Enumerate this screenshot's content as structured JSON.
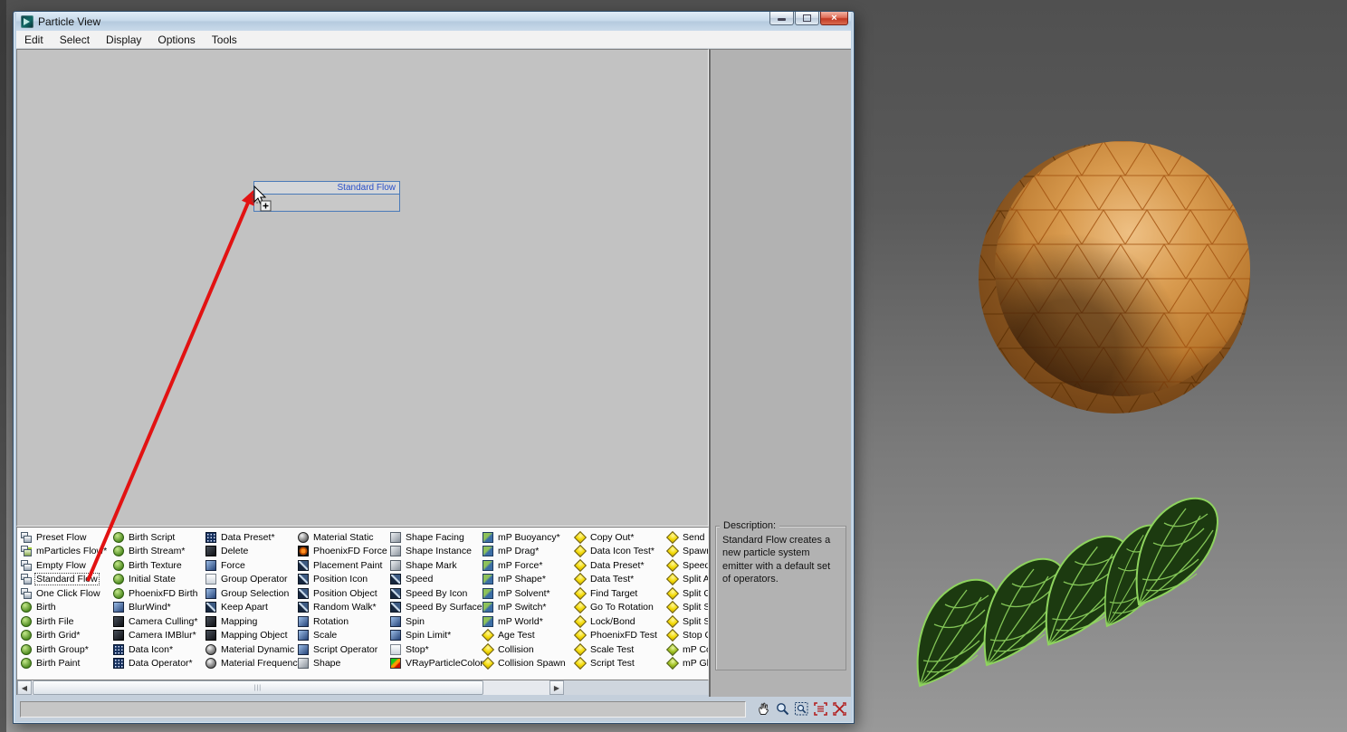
{
  "window": {
    "title": "Particle View",
    "controls": [
      "minimize",
      "restore",
      "close"
    ],
    "menu": {
      "items": [
        "Edit",
        "Select",
        "Display",
        "Options",
        "Tools"
      ]
    }
  },
  "canvas": {
    "node": {
      "title": "Standard Flow"
    }
  },
  "description_panel": {
    "label": "Description:",
    "text": "Standard Flow creates a new particle system emitter with a default set of operators."
  },
  "depot": {
    "columns": [
      {
        "items": [
          {
            "label": "Preset Flow",
            "icon": "flow"
          },
          {
            "label": "mParticles Flow*",
            "icon": "flow-m"
          },
          {
            "label": "Empty Flow",
            "icon": "flow"
          },
          {
            "label": "Standard Flow",
            "icon": "flow",
            "selected": true
          },
          {
            "label": "One Click Flow",
            "icon": "flow"
          },
          {
            "label": "Birth",
            "icon": "green"
          },
          {
            "label": "Birth File",
            "icon": "green"
          },
          {
            "label": "Birth Grid*",
            "icon": "green"
          },
          {
            "label": "Birth Group*",
            "icon": "green"
          },
          {
            "label": "Birth Paint",
            "icon": "green"
          }
        ]
      },
      {
        "items": [
          {
            "label": "Birth Script",
            "icon": "green"
          },
          {
            "label": "Birth Stream*",
            "icon": "green"
          },
          {
            "label": "Birth Texture",
            "icon": "green"
          },
          {
            "label": "Initial State",
            "icon": "green"
          },
          {
            "label": "PhoenixFD Birth",
            "icon": "green"
          },
          {
            "label": "BlurWind*",
            "icon": "blue"
          },
          {
            "label": "Camera Culling*",
            "icon": "dark"
          },
          {
            "label": "Camera IMBlur*",
            "icon": "dark"
          },
          {
            "label": "Data Icon*",
            "icon": "data"
          },
          {
            "label": "Data Operator*",
            "icon": "data"
          }
        ]
      },
      {
        "items": [
          {
            "label": "Data Preset*",
            "icon": "data"
          },
          {
            "label": "Delete",
            "icon": "dark"
          },
          {
            "label": "Force",
            "icon": "blue"
          },
          {
            "label": "Group Operator",
            "icon": "light"
          },
          {
            "label": "Group Selection",
            "icon": "blue"
          },
          {
            "label": "Keep Apart",
            "icon": "navy"
          },
          {
            "label": "Mapping",
            "icon": "dark"
          },
          {
            "label": "Mapping Object",
            "icon": "dark"
          },
          {
            "label": "Material Dynamic",
            "icon": "sphere"
          },
          {
            "label": "Material Frequency",
            "icon": "sphere"
          }
        ]
      },
      {
        "items": [
          {
            "label": "Material Static",
            "icon": "sphere"
          },
          {
            "label": "PhoenixFD Force",
            "icon": "orange"
          },
          {
            "label": "Placement Paint",
            "icon": "navy"
          },
          {
            "label": "Position Icon",
            "icon": "navy"
          },
          {
            "label": "Position Object",
            "icon": "navy"
          },
          {
            "label": "Random Walk*",
            "icon": "navy"
          },
          {
            "label": "Rotation",
            "icon": "blue"
          },
          {
            "label": "Scale",
            "icon": "blue"
          },
          {
            "label": "Script Operator",
            "icon": "blue"
          },
          {
            "label": "Shape",
            "icon": "gray"
          }
        ]
      },
      {
        "items": [
          {
            "label": "Shape Facing",
            "icon": "gray"
          },
          {
            "label": "Shape Instance",
            "icon": "gray"
          },
          {
            "label": "Shape Mark",
            "icon": "gray"
          },
          {
            "label": "Speed",
            "icon": "navy"
          },
          {
            "label": "Speed By Icon",
            "icon": "navy"
          },
          {
            "label": "Speed By Surface",
            "icon": "navy"
          },
          {
            "label": "Spin",
            "icon": "blue"
          },
          {
            "label": "Spin Limit*",
            "icon": "blue"
          },
          {
            "label": "Stop*",
            "icon": "light"
          },
          {
            "label": "VRayParticleColor",
            "icon": "vray"
          }
        ]
      },
      {
        "items": [
          {
            "label": "mP Buoyancy*",
            "icon": "mp"
          },
          {
            "label": "mP Drag*",
            "icon": "mp"
          },
          {
            "label": "mP Force*",
            "icon": "mp"
          },
          {
            "label": "mP Shape*",
            "icon": "mp"
          },
          {
            "label": "mP Solvent*",
            "icon": "mp"
          },
          {
            "label": "mP Switch*",
            "icon": "mp"
          },
          {
            "label": "mP World*",
            "icon": "mp"
          },
          {
            "label": "Age Test",
            "icon": "diamond"
          },
          {
            "label": "Collision",
            "icon": "diamond"
          },
          {
            "label": "Collision Spawn",
            "icon": "diamond"
          }
        ]
      },
      {
        "items": [
          {
            "label": "Copy Out*",
            "icon": "diamond"
          },
          {
            "label": "Data Icon Test*",
            "icon": "diamond"
          },
          {
            "label": "Data Preset*",
            "icon": "diamond"
          },
          {
            "label": "Data Test*",
            "icon": "diamond"
          },
          {
            "label": "Find Target",
            "icon": "diamond"
          },
          {
            "label": "Go To Rotation",
            "icon": "diamond"
          },
          {
            "label": "Lock/Bond",
            "icon": "diamond"
          },
          {
            "label": "PhoenixFD Test",
            "icon": "diamond"
          },
          {
            "label": "Scale Test",
            "icon": "diamond"
          },
          {
            "label": "Script Test",
            "icon": "diamond"
          }
        ]
      },
      {
        "items": [
          {
            "label": "Send",
            "icon": "diamond"
          },
          {
            "label": "Spawn",
            "icon": "diamond"
          },
          {
            "label": "Speed",
            "icon": "diamond"
          },
          {
            "label": "Split A",
            "icon": "diamond"
          },
          {
            "label": "Split G",
            "icon": "diamond"
          },
          {
            "label": "Split S",
            "icon": "diamond"
          },
          {
            "label": "Split S",
            "icon": "diamond"
          },
          {
            "label": "Stop G",
            "icon": "diamond"
          },
          {
            "label": "mP Co",
            "icon": "mp-diamond"
          },
          {
            "label": "mP Glu",
            "icon": "mp-diamond"
          }
        ]
      }
    ]
  },
  "toolbar": {
    "tools": [
      "pan-tool",
      "zoom-tool",
      "region-zoom-tool",
      "zoom-extents-tool",
      "zoom-cancel-tool"
    ]
  },
  "colors": {
    "node_border": "#4a7ab8",
    "node_title_text": "#2b50c8",
    "drag_arrow": "#e21212"
  },
  "viewport": {
    "background_top": "#525252",
    "background_bottom": "#989898",
    "sphere": {
      "base_color": "#c9883f",
      "wire_color": "#a0500e"
    },
    "leaves": {
      "fill_color": "#1c3a10",
      "wire_color": "#8ed45e",
      "count": 5
    }
  }
}
